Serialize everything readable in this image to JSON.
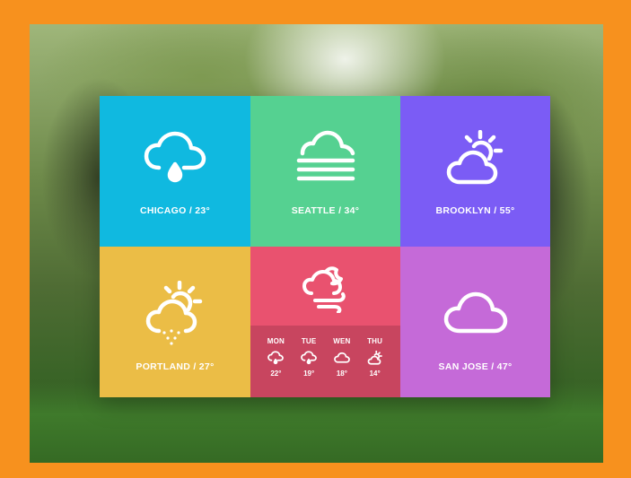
{
  "tiles": {
    "chicago": {
      "label": "CHICAGO / 23°",
      "icon": "rain-cloud-icon",
      "color": "#10b9e0"
    },
    "seattle": {
      "label": "SEATTLE / 34°",
      "icon": "fog-cloud-icon",
      "color": "#55d191"
    },
    "brooklyn": {
      "label": "BROOKLYN / 55°",
      "icon": "partly-sunny-icon",
      "color": "#7b5cf5"
    },
    "portland": {
      "label": "PORTLAND / 27°",
      "icon": "sun-cloud-hail-icon",
      "color": "#ebbd46"
    },
    "center": {
      "icon": "night-wind-icon",
      "color": "#e9526f"
    },
    "sanjose": {
      "label": "SAN JOSE / 47°",
      "icon": "cloud-icon",
      "color": "#c56ad8"
    }
  },
  "forecast": [
    {
      "day": "MON",
      "temp": "22°",
      "icon": "rain-cloud-icon"
    },
    {
      "day": "TUE",
      "temp": "19°",
      "icon": "rain-cloud-icon"
    },
    {
      "day": "WEN",
      "temp": "18°",
      "icon": "cloud-icon"
    },
    {
      "day": "THU",
      "temp": "14°",
      "icon": "partly-sunny-icon"
    }
  ]
}
